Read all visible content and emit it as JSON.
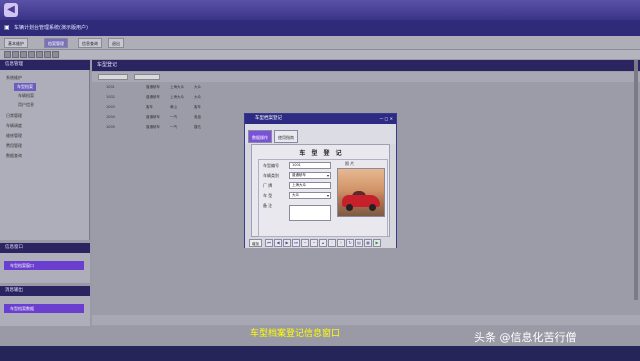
{
  "app": {
    "title": "车辆计划台管理系统(演示版用户)",
    "menu": [
      "基本维护",
      "档案管理",
      "信息查询",
      "退出"
    ]
  },
  "sidebar": {
    "panel_title": "信息管理",
    "items": [
      {
        "label": "系统维护",
        "level": 0
      },
      {
        "label": "车型档案",
        "level": 1
      },
      {
        "label": "车辆档案",
        "level": 1
      },
      {
        "label": "用户信息",
        "level": 1
      },
      {
        "label": "日常管理",
        "level": 0
      },
      {
        "label": "车辆调度",
        "level": 0
      },
      {
        "label": "维修管理",
        "level": 0
      },
      {
        "label": "费用管理",
        "level": 0
      },
      {
        "label": "数据查询",
        "level": 0
      }
    ],
    "panel2_title": "信息窗口",
    "panel2_item": "车型档案窗口",
    "panel3_title": "消息输出",
    "panel3_item": "车型档案数据"
  },
  "main": {
    "header": "车型登记",
    "rows": [
      {
        "no": "1001",
        "type": "普通轿车",
        "factory": "上海大众",
        "model": "大众"
      },
      {
        "no": "1002",
        "type": "普通轿车",
        "factory": "上海大众",
        "model": "大众"
      },
      {
        "no": "1003",
        "type": "客车",
        "factory": "黄山",
        "model": "客车"
      },
      {
        "no": "1004",
        "type": "普通轿车",
        "factory": "一汽",
        "model": "奥迪"
      },
      {
        "no": "1005",
        "type": "普通轿车",
        "factory": "一汽",
        "model": "捷达"
      }
    ]
  },
  "dialog": {
    "title": "车型档案登记",
    "tabs": [
      "数据操作",
      "使用指南"
    ],
    "form_title": "车 型 登 记",
    "photo_label": "照 片",
    "fields": [
      {
        "label": "车型编号",
        "value": "1001",
        "select": false
      },
      {
        "label": "车辆类别",
        "value": "普通轿车",
        "select": true
      },
      {
        "label": "厂    牌",
        "value": "上海大众",
        "select": false
      },
      {
        "label": "车    型",
        "value": "大众",
        "select": true
      },
      {
        "label": "备    注",
        "value": "",
        "select": false
      }
    ],
    "nav_label": "增加"
  },
  "caption": "车型档案登记信息窗口",
  "watermark": "头条 @信息化苦行僧",
  "colors": {
    "accent": "#6a3fd0",
    "title_bar": "#2c2a82",
    "caption": "#ffff00"
  }
}
